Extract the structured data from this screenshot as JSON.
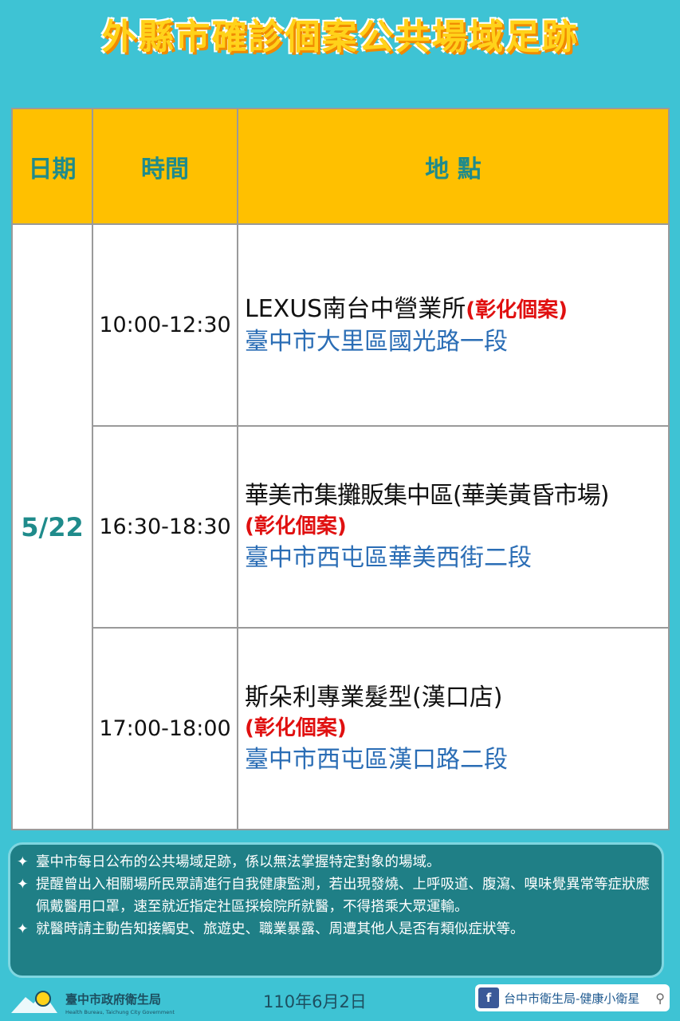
{
  "title": "外縣市確診個案公共場域足跡",
  "table": {
    "headers": {
      "date": "日期",
      "time": "時間",
      "place": "地 點"
    },
    "date": "5/22",
    "rows": [
      {
        "time": "10:00-12:30",
        "place_name": "LEXUS南台中營業所",
        "case_tag": "(彰化個案)",
        "address": "臺中市大里區國光路一段"
      },
      {
        "time": "16:30-18:30",
        "place_name": "華美市集攤販集中區(華美黃昏市場)",
        "case_tag": "(彰化個案)",
        "address": "臺中市西屯區華美西街二段"
      },
      {
        "time": "17:00-18:00",
        "place_name": "斯朵利專業髮型(漢口店)",
        "case_tag": "(彰化個案)",
        "address": "臺中市西屯區漢口路二段"
      }
    ]
  },
  "notes": {
    "bullet": "✦",
    "items": [
      "臺中市每日公布的公共場域足跡，係以無法掌握特定對象的場域。",
      "提醒曾出入相關場所民眾請進行自我健康監測，若出現發燒、上呼吸道、腹瀉、嗅味覺異常等症狀應佩戴醫用口罩，速至就近指定社區採檢院所就醫，不得搭乘大眾運輸。",
      "就醫時請主動告知接觸史、旅遊史、職業暴露、周遭其他人是否有類似症狀等。"
    ]
  },
  "footer": {
    "org_name": "臺中市政府衛生局",
    "org_name_en": "Health Bureau, Taichung City Government",
    "date": "110年6月2日",
    "fb_label": "台中市衛生局-健康小衛星",
    "fb_icon": "facebook-icon",
    "search_icon": "search-icon"
  }
}
